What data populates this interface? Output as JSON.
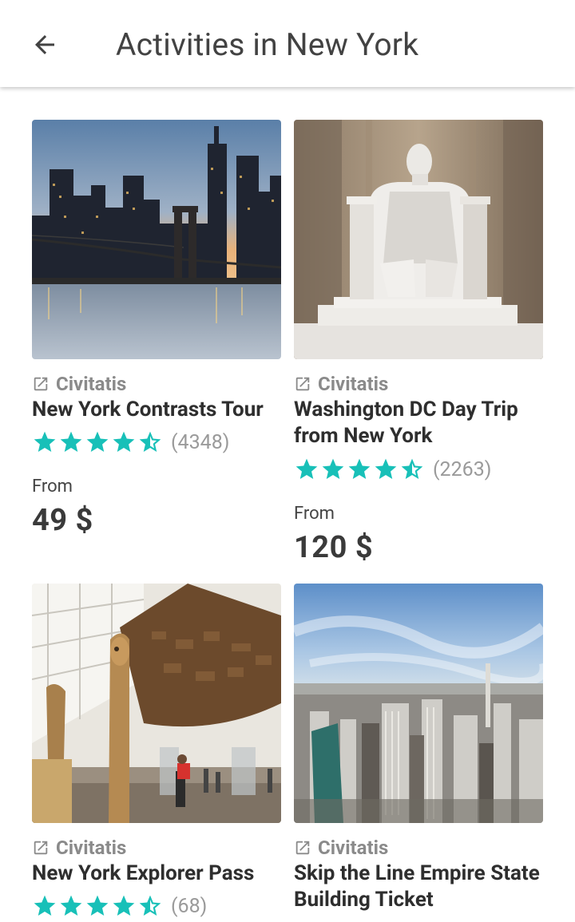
{
  "header": {
    "title": "Activities in New York",
    "back_icon": "arrow-left-icon"
  },
  "theme": {
    "star_color": "#18c0b8",
    "provider_color": "#8a8a8a",
    "price_color": "#3a3a3a"
  },
  "activities": [
    {
      "provider": "Civitatis",
      "name": "New York Contrasts Tour",
      "rating": 4.5,
      "reviews": "(4348)",
      "from_label": "From",
      "price": "49 $",
      "image": "brooklyn-bridge-skyline-dusk"
    },
    {
      "provider": "Civitatis",
      "name": "Washington DC Day Trip from New York",
      "rating": 4.5,
      "reviews": "(2263)",
      "from_label": "From",
      "price": "120 $",
      "image": "lincoln-memorial-statue"
    },
    {
      "provider": "Civitatis",
      "name": "New York Explorer Pass",
      "rating": 4.5,
      "reviews": "(68)",
      "image": "museum-gallery-totems"
    },
    {
      "provider": "Civitatis",
      "name": "Skip the Line Empire State Building Ticket",
      "image": "manhattan-aerial-view"
    }
  ]
}
